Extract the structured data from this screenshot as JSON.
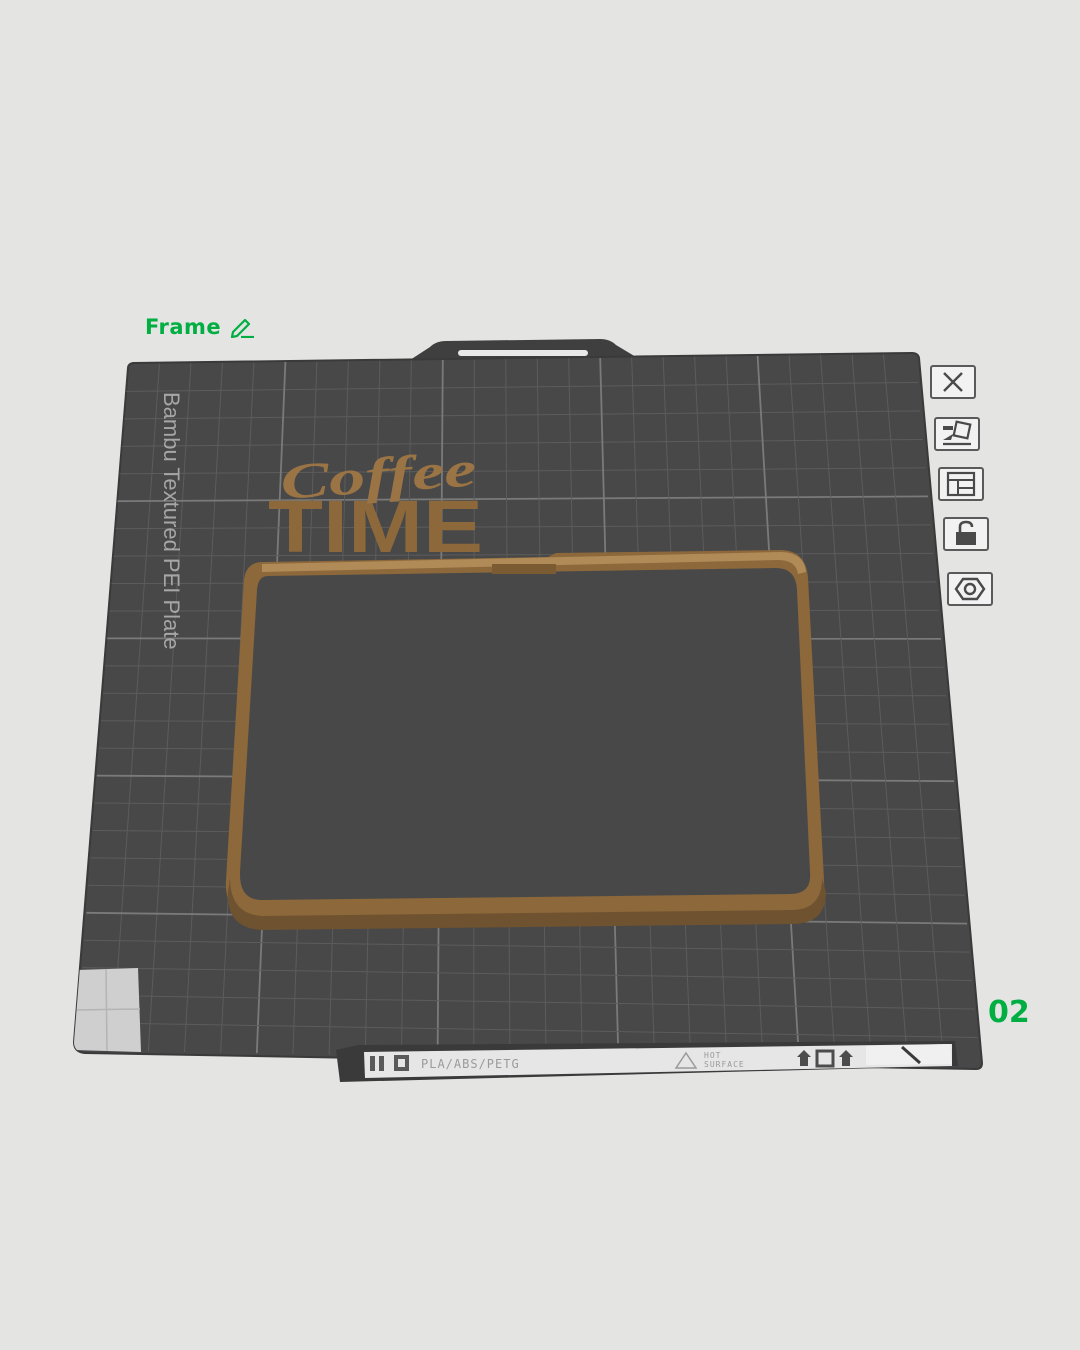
{
  "plate": {
    "name": "Frame",
    "index": "02",
    "bed_label": "Bambu Textured PEI Plate",
    "strip": {
      "filaments": "PLA/ABS/PETG",
      "warning_line1": "HOT",
      "warning_line2": "SURFACE"
    }
  },
  "model": {
    "line1": "Coffee",
    "line2": "TIME"
  },
  "toolbar": {
    "items": [
      {
        "name": "delete-plate",
        "icon": "close-icon"
      },
      {
        "name": "auto-orient",
        "icon": "orient-icon"
      },
      {
        "name": "arrange",
        "icon": "arrange-icon"
      },
      {
        "name": "lock-plate",
        "icon": "unlock-icon"
      },
      {
        "name": "plate-settings",
        "icon": "settings-icon"
      }
    ]
  },
  "colors": {
    "accent": "#00ae42",
    "background": "#e4e4e3",
    "bed": "#484848",
    "filament": "#8c683b"
  }
}
